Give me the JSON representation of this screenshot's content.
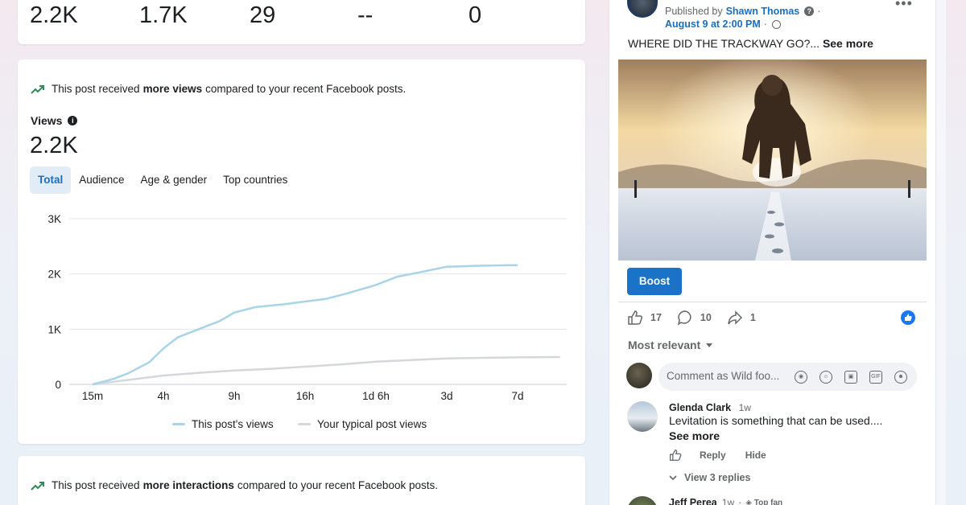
{
  "metrics": {
    "values": [
      "2.2K",
      "1.7K",
      "29",
      "--",
      "0"
    ]
  },
  "views_card": {
    "trend_prefix": "This post received",
    "trend_bold": "more views",
    "trend_suffix": "compared to your recent Facebook posts.",
    "views_label": "Views",
    "views_value": "2.2K",
    "tabs": [
      "Total",
      "Audience",
      "Age & gender",
      "Top countries"
    ],
    "active_tab": "Total"
  },
  "chart_data": {
    "type": "line",
    "x": [
      "15m",
      "4h",
      "9h",
      "16h",
      "1d 6h",
      "3d",
      "7d"
    ],
    "ylim": [
      0,
      3000
    ],
    "yticks": [
      "0",
      "1K",
      "2K",
      "3K"
    ],
    "series": [
      {
        "name": "This post's views",
        "color": "#a8d4ea",
        "points": [
          [
            0,
            0
          ],
          [
            0.3,
            100
          ],
          [
            0.5,
            200
          ],
          [
            0.8,
            400
          ],
          [
            1,
            650
          ],
          [
            1.2,
            850
          ],
          [
            1.5,
            1000
          ],
          [
            1.8,
            1150
          ],
          [
            2,
            1300
          ],
          [
            2.3,
            1400
          ],
          [
            2.7,
            1450
          ],
          [
            3,
            1500
          ],
          [
            3.3,
            1550
          ],
          [
            3.6,
            1650
          ],
          [
            4,
            1800
          ],
          [
            4.3,
            1950
          ],
          [
            4.7,
            2050
          ],
          [
            5,
            2130
          ],
          [
            5.5,
            2150
          ],
          [
            6,
            2160
          ]
        ]
      },
      {
        "name": "Your typical post views",
        "color": "#d5d7da",
        "points": [
          [
            0,
            0
          ],
          [
            0.5,
            80
          ],
          [
            1,
            160
          ],
          [
            1.5,
            210
          ],
          [
            2,
            250
          ],
          [
            2.5,
            280
          ],
          [
            3,
            320
          ],
          [
            3.5,
            360
          ],
          [
            4,
            410
          ],
          [
            4.5,
            440
          ],
          [
            5,
            470
          ],
          [
            5.5,
            480
          ],
          [
            6,
            490
          ],
          [
            6.6,
            495
          ]
        ]
      }
    ],
    "legend": [
      "This post's views",
      "Your typical post views"
    ]
  },
  "interactions_card": {
    "trend_prefix": "This post received",
    "trend_bold": "more interactions",
    "trend_suffix": "compared to your recent Facebook posts."
  },
  "post": {
    "published_by_prefix": "Published by",
    "author": "Shawn Thomas",
    "date": "August 9 at 2:00 PM",
    "text": "WHERE DID THE TRACKWAY GO?...",
    "see_more": "See more",
    "boost_label": "Boost",
    "likes": "17",
    "comments": "10",
    "shares": "1",
    "sort_label": "Most relevant",
    "comment_placeholder": "Comment as Wild foo...",
    "comments_list": [
      {
        "name": "Glenda Clark",
        "time": "1w",
        "text": "Levitation is something that can be used....",
        "see_more": "See more",
        "reply": "Reply",
        "hide": "Hide",
        "view_replies": "View 3 replies"
      },
      {
        "name": "Jeff Perea",
        "time": "1w",
        "badge": "Top fan"
      }
    ]
  }
}
